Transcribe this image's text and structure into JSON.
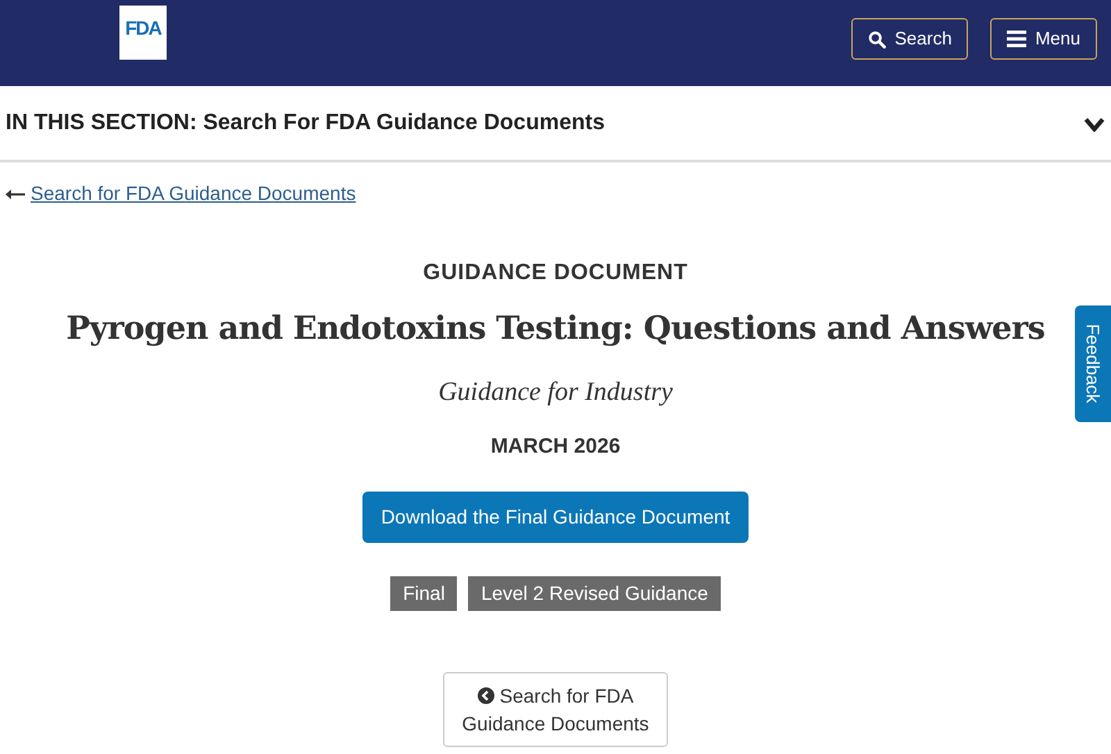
{
  "header": {
    "logo": "FDA",
    "buttons": [
      {
        "kind": "search",
        "label": "Search"
      },
      {
        "kind": "menu",
        "label": "Menu"
      }
    ]
  },
  "section_bar": {
    "label": "IN THIS SECTION: Search For FDA Guidance Documents",
    "expanded": false
  },
  "back_link": "Search for FDA Guidance Documents",
  "eyebrow": "GUIDANCE DOCUMENT",
  "title": "Pyrogen and Endotoxins Testing: Questions and Answers",
  "subtitle": "Guidance for Industry",
  "date": "MARCH 2026",
  "download_button": "Download the Final Guidance Document",
  "tags": [
    "Final",
    "Level 2 Revised Guidance"
  ],
  "return_button": [
    "Search for FDA",
    "Guidance Documents"
  ],
  "feedback_tab": "Feedback"
}
